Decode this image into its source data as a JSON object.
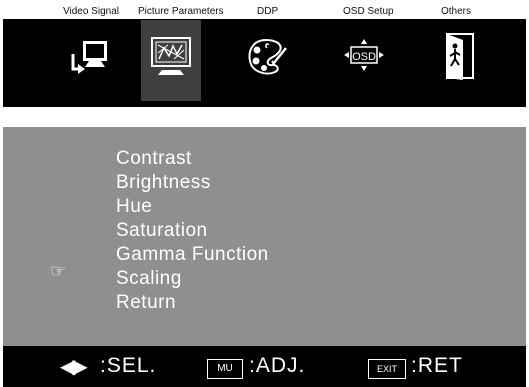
{
  "tabs": [
    {
      "label": "Video Signal",
      "icon": "input-signal-icon"
    },
    {
      "label": "Picture Parameters",
      "icon": "picture-icon",
      "selected": true
    },
    {
      "label": "DDP",
      "icon": "palette-icon"
    },
    {
      "label": "OSD Setup",
      "icon": "osd-icon"
    },
    {
      "label": "Others",
      "icon": "exit-door-icon"
    }
  ],
  "osd_icon_text": "OSD",
  "menu": {
    "items": [
      "Contrast",
      "Brightness",
      "Hue",
      "Saturation",
      "Gamma Function",
      "Scaling",
      "Return"
    ],
    "pointer": "☞"
  },
  "footer": {
    "sel_arrows": "◀▶",
    "sel_label": ":SEL.",
    "adj_key": "MU",
    "adj_label": ":ADJ.",
    "ret_key": "EXIT",
    "ret_label": ":RET"
  },
  "colors": {
    "panel_bg": "#8f8f8f",
    "bar_bg": "#000000",
    "selected_bg": "#3f3f3f"
  }
}
